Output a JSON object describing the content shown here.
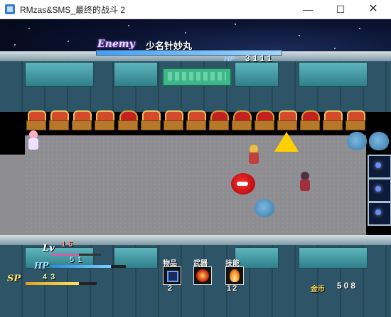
{
  "window": {
    "title": "RMzas&SMS_最终的战斗 2",
    "minimize_icon": "—",
    "maximize_icon": "☐",
    "close_icon": "✕"
  },
  "enemy": {
    "label": "Enemy",
    "name": "少名针妙丸",
    "hp_label": "HP",
    "hp_value": "3111",
    "hp_fraction": 1.0
  },
  "player": {
    "lv_label": "Lv",
    "lv_value": "16",
    "hp_label": "HP",
    "hp_value": "51",
    "hp_fraction": 0.8,
    "sp_label": "SP",
    "sp_value": "43",
    "sp_fraction": 0.75,
    "exp_fraction": 0.55
  },
  "slots": {
    "item_label": "物品",
    "item_count": "2",
    "weapon_label": "武器",
    "skill_label": "技能",
    "skill_count": "12"
  },
  "gold": {
    "label": "金币",
    "value": "508"
  },
  "colors": {
    "enemy_hp": "#3aa0ff",
    "player_hp": "#2a8ad8",
    "player_sp": "#e0a020"
  }
}
